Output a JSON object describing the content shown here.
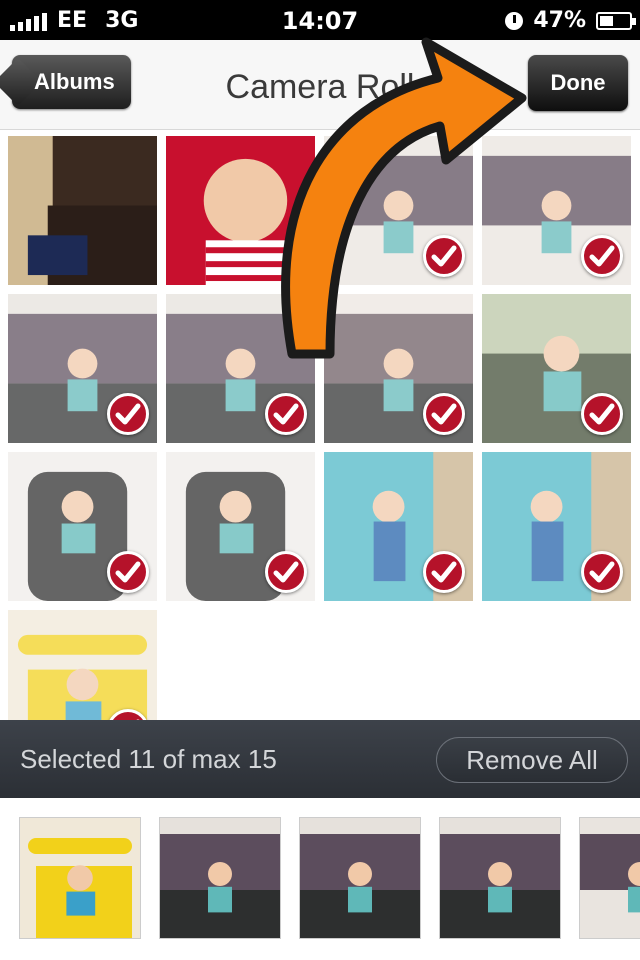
{
  "status_bar": {
    "carrier": "EE",
    "network": "3G",
    "time": "14:07",
    "battery": "47%",
    "battery_level": 0.47
  },
  "nav": {
    "back_label": "Albums",
    "title": "Camera Roll",
    "done_label": "Done"
  },
  "photos": [
    {
      "scene": "room",
      "selected": false
    },
    {
      "scene": "baby-red",
      "selected": false
    },
    {
      "scene": "sofa",
      "selected": true
    },
    {
      "scene": "sofa",
      "selected": true
    },
    {
      "scene": "sofa-table",
      "selected": true
    },
    {
      "scene": "sofa-table",
      "selected": true
    },
    {
      "scene": "sofa-toy",
      "selected": true
    },
    {
      "scene": "garden",
      "selected": true
    },
    {
      "scene": "chair",
      "selected": true
    },
    {
      "scene": "chair",
      "selected": true
    },
    {
      "scene": "door",
      "selected": true
    },
    {
      "scene": "door",
      "selected": true
    },
    {
      "scene": "toy-car",
      "selected": true
    }
  ],
  "selection": {
    "text": "Selected 11 of max 15",
    "remove_label": "Remove All"
  },
  "thumbnails": [
    {
      "scene": "toy-car"
    },
    {
      "scene": "sofa-table"
    },
    {
      "scene": "sofa-table"
    },
    {
      "scene": "sofa-table"
    },
    {
      "scene": "sofa"
    }
  ],
  "colors": {
    "check": "#b5122a",
    "arrow": "#f5820f",
    "selection_bar": "#33373d"
  }
}
